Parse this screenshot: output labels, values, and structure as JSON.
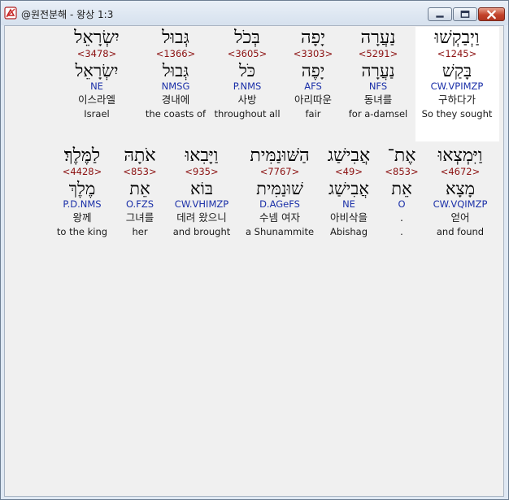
{
  "window": {
    "title": "@원전분해 - 왕상 1:3",
    "icons": {
      "app": "bible-app-icon",
      "minimize": "minimize-icon",
      "maximize": "maximize-icon",
      "close": "close-icon"
    }
  },
  "rows": [
    [
      {
        "hebrew": "יִשְׂרָאֵל",
        "strong": "<3478>",
        "root": "יִשְׂרָאֵל",
        "morph": "NE",
        "korean": "이스라엘",
        "english": "Israel"
      },
      {
        "hebrew": "גְּבוּל",
        "strong": "<1366>",
        "root": "גְּבוּל",
        "morph": "NMSG",
        "korean": "경내에",
        "english": "the coasts of"
      },
      {
        "hebrew": "בְּכֹל",
        "strong": "<3605>",
        "root": "כֹּל",
        "morph": "P.NMS",
        "korean": "사방",
        "english": "throughout all"
      },
      {
        "hebrew": "יָפָה",
        "strong": "<3303>",
        "root": "יָפֶה",
        "morph": "AFS",
        "korean": "아리따운",
        "english": "fair"
      },
      {
        "hebrew": "נַעֲרָה",
        "strong": "<5291>",
        "root": "נַעֲרָה",
        "morph": "NFS",
        "korean": "동녀를",
        "english": "for a-damsel"
      },
      {
        "hebrew": "וַיְבַקְשׁוּ",
        "strong": "<1245>",
        "root": "בָּקַשׁ",
        "morph": "CW.VPIMZP",
        "korean": "구하다가",
        "english": "So they sought"
      }
    ],
    [
      {
        "hebrew": "לַמֶּלֶךְ׃",
        "strong": "<4428>",
        "root": "מֶלֶךְ",
        "morph": "P.D.NMS",
        "korean": "왕께",
        "english": "to the king"
      },
      {
        "hebrew": "אֹתָהּ",
        "strong": "<853>",
        "root": "אֵת",
        "morph": "O.FZS",
        "korean": "그녀를",
        "english": "her"
      },
      {
        "hebrew": "וַיָּבִאוּ",
        "strong": "<935>",
        "root": "בּוֹא",
        "morph": "CW.VHIMZP",
        "korean": "데려 왔으니",
        "english": "and brought"
      },
      {
        "hebrew": "הַשּׁוּנַמִּית",
        "strong": "<7767>",
        "root": "שׁוּנַמִּית",
        "morph": "D.AGeFS",
        "korean": "수넴 여자",
        "english": "a Shunammite"
      },
      {
        "hebrew": "אֲבִישַׁג",
        "strong": "<49>",
        "root": "אֲבִישַׁג",
        "morph": "NE",
        "korean": "아비삭을",
        "english": "Abishag"
      },
      {
        "hebrew": "אֶת־",
        "strong": "<853>",
        "root": "אֵת",
        "morph": "O",
        "korean": ".",
        "english": "."
      },
      {
        "hebrew": "וַיִּמְצְאוּ",
        "strong": "<4672>",
        "root": "מָצָא",
        "morph": "CW.VQIMZP",
        "korean": "얻어",
        "english": "and found"
      }
    ]
  ]
}
